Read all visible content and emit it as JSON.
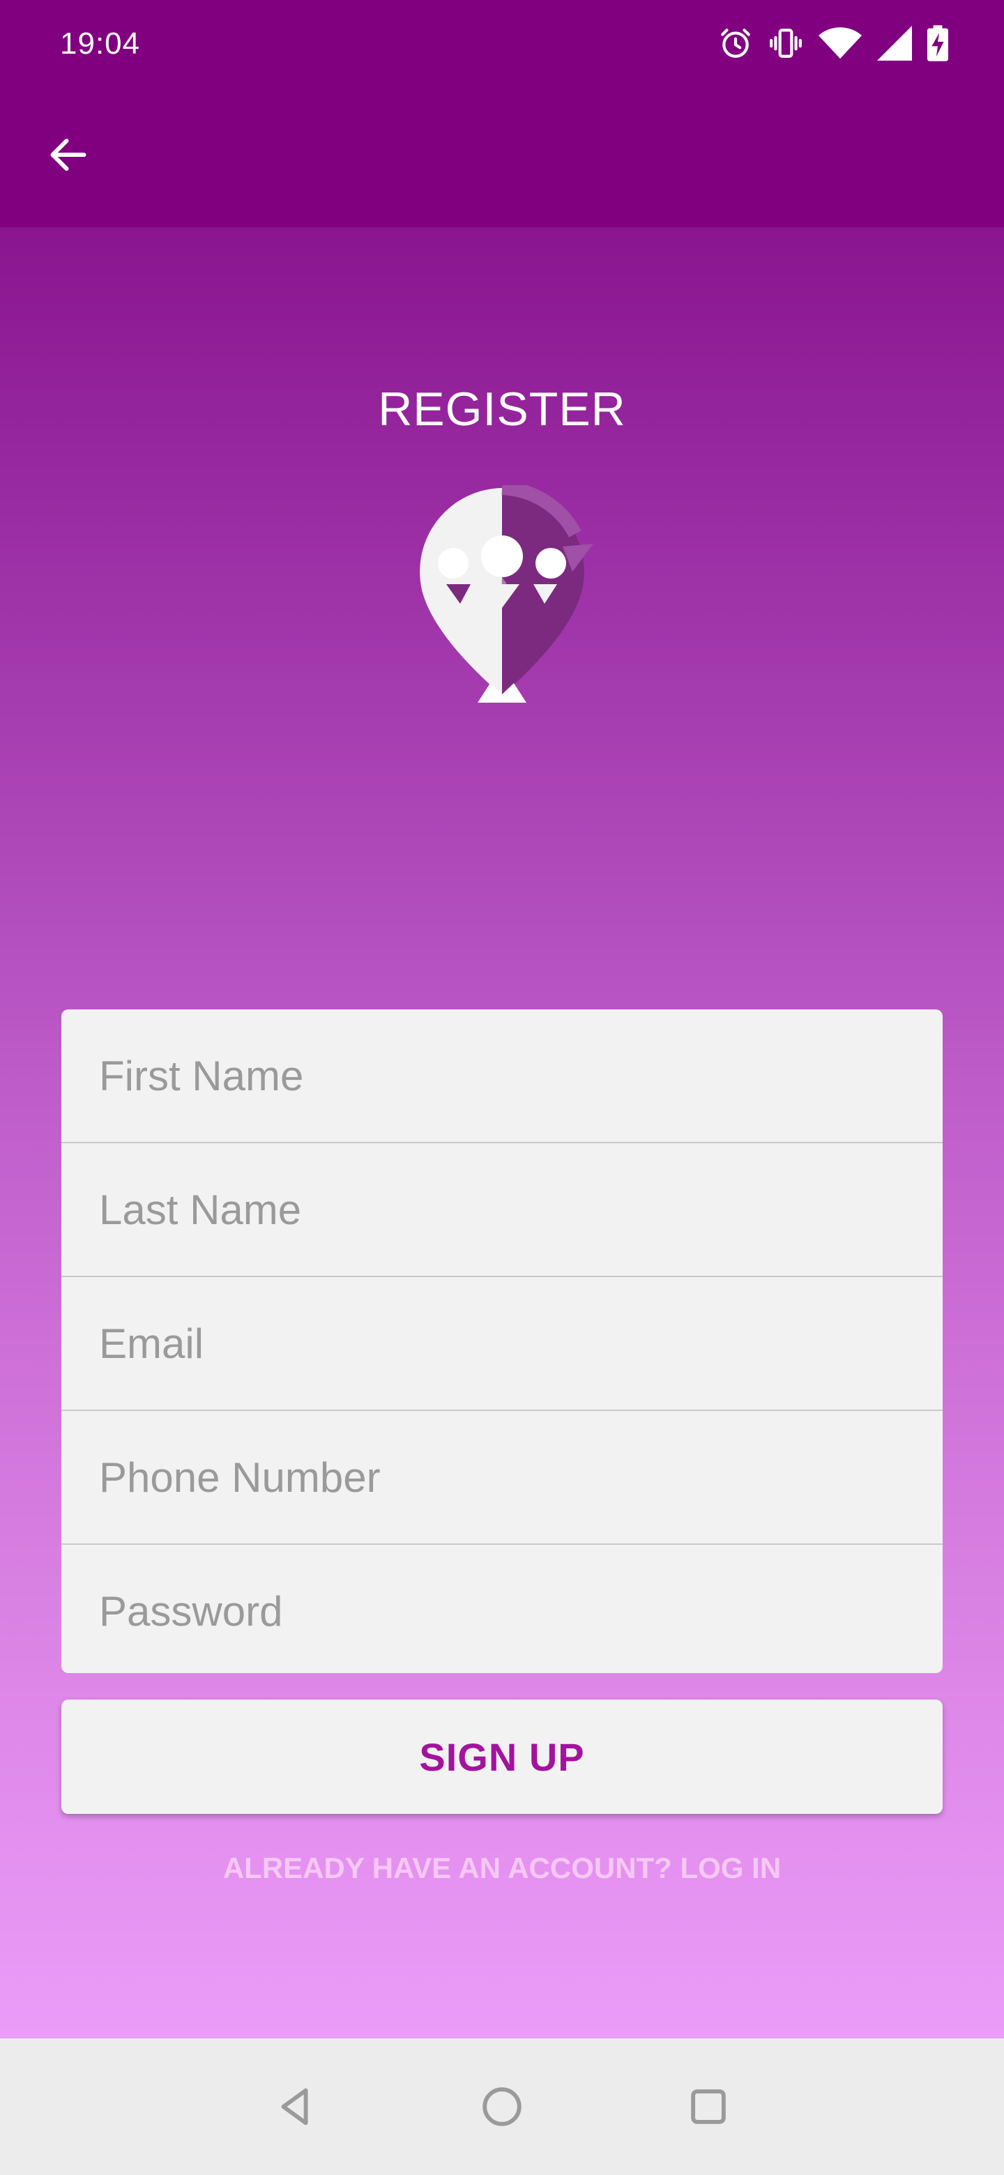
{
  "status_bar": {
    "time": "19:04",
    "icons": [
      "alarm-icon",
      "vibrate-icon",
      "wifi-icon",
      "signal-icon",
      "battery-charging-icon"
    ]
  },
  "app_bar": {
    "back_icon": "arrow-left-icon"
  },
  "screen": {
    "title": "REGISTER",
    "logo_icon": "group-location-pin-icon"
  },
  "form": {
    "first_name": {
      "placeholder": "First Name",
      "value": ""
    },
    "last_name": {
      "placeholder": "Last Name",
      "value": ""
    },
    "email": {
      "placeholder": "Email",
      "value": ""
    },
    "phone": {
      "placeholder": "Phone Number",
      "value": ""
    },
    "password": {
      "placeholder": "Password",
      "value": ""
    }
  },
  "actions": {
    "signup_label": "SIGN UP",
    "login_link_label": "ALREADY HAVE AN ACCOUNT? LOG IN"
  },
  "nav_bar": {
    "icons": [
      "back-triangle-icon",
      "home-circle-icon",
      "recents-square-icon"
    ]
  },
  "colors": {
    "app_bar": "#800080",
    "gradient_top": "#8a1590",
    "gradient_bottom": "#eb9cf9",
    "signup_text": "#a3139e",
    "login_link": "#f6c8f4",
    "field_background": "#f2f2f2"
  }
}
